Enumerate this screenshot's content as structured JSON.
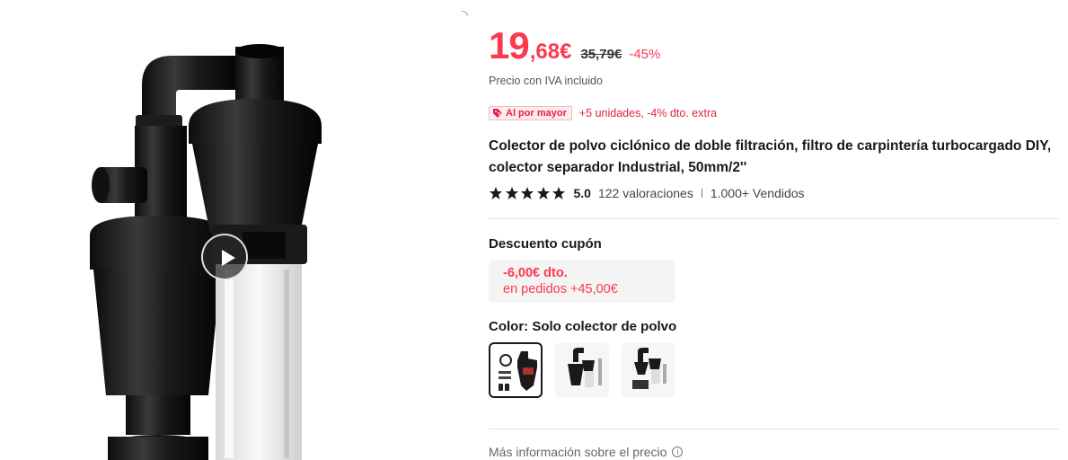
{
  "product": {
    "title": "Colector de polvo ciclónico de doble filtración, filtro de carpintería turbocargado DIY, colector separador Industrial, 50mm/2''",
    "images_alt": "product-image"
  },
  "price": {
    "integer": "19",
    "decimal": ",68€",
    "original": "35,79€",
    "discount": "-45%",
    "vat_note": "Precio con IVA incluido",
    "accent": "#fd384f"
  },
  "bulk": {
    "tag_label": "Al por mayor",
    "text": "+5 unidades, -4% dto. extra"
  },
  "rating": {
    "stars": 5,
    "score": "5.0",
    "count": "122 valoraciones",
    "sold": "1.000+ Vendidos"
  },
  "coupon": {
    "title": "Descuento cupón",
    "amount": "-6,00€ dto.",
    "condition": "en pedidos +45,00€"
  },
  "color": {
    "label": "Color: Solo colector de polvo",
    "selected_index": 0,
    "options_count": 3
  },
  "more_info": {
    "label": "Más información sobre el precio",
    "icon": "info-icon"
  },
  "media": {
    "play_icon": "play-icon"
  }
}
